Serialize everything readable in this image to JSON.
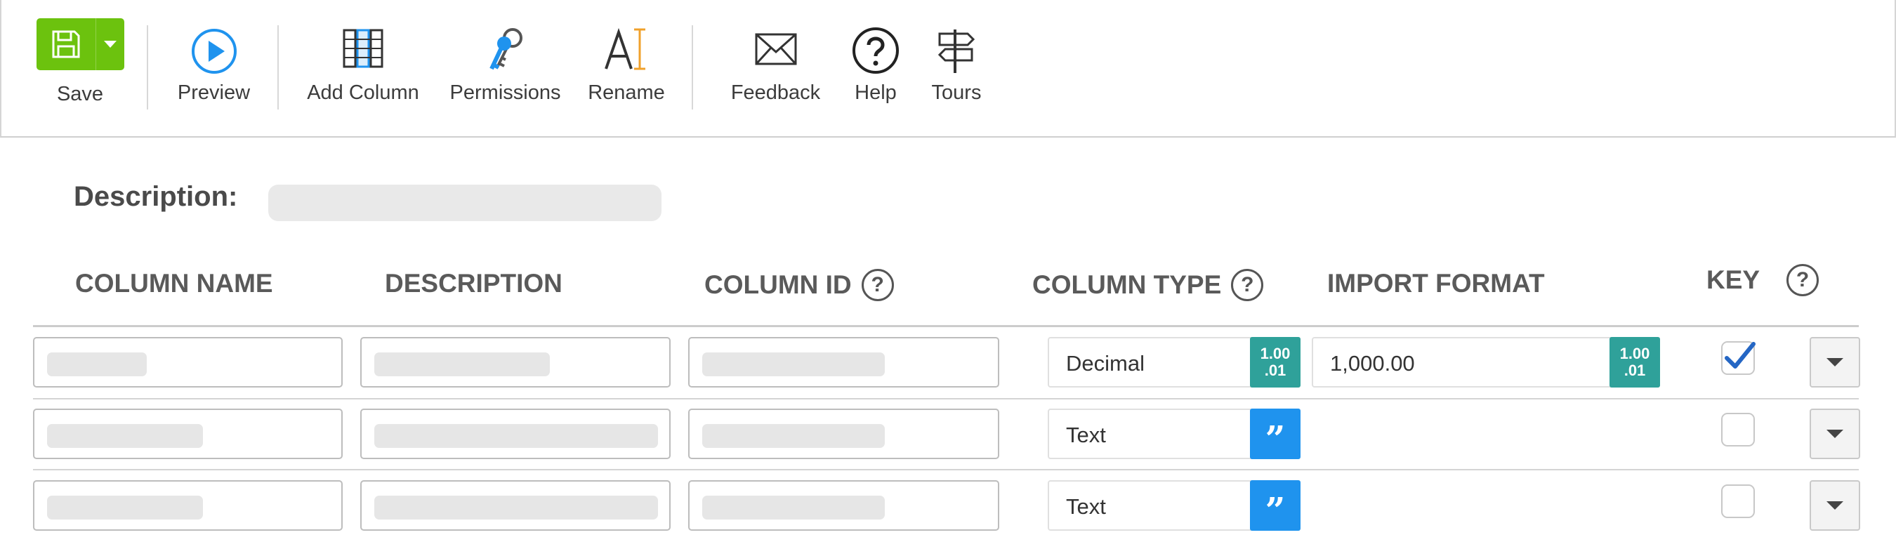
{
  "toolbar": {
    "save_label": "Save",
    "preview_label": "Preview",
    "add_column_label": "Add Column",
    "permissions_label": "Permissions",
    "rename_label": "Rename",
    "feedback_label": "Feedback",
    "help_label": "Help",
    "tours_label": "Tours",
    "icons": {
      "save": "floppy-disk-icon",
      "save_dropdown": "caret-down-icon",
      "preview": "play-circle-icon",
      "add_column": "columns-icon",
      "permissions": "keys-icon",
      "rename": "text-cursor-icon",
      "feedback": "envelope-icon",
      "help": "question-circle-icon",
      "tours": "signpost-icon"
    },
    "save_color": "#6cc20e",
    "preview_color": "#1f93ee"
  },
  "description": {
    "label": "Description:",
    "value": ""
  },
  "columns": {
    "headers": {
      "column_name": "COLUMN NAME",
      "description": "DESCRIPTION",
      "column_id": "COLUMN ID",
      "column_type": "COLUMN TYPE",
      "import_format": "IMPORT FORMAT",
      "key": "KEY"
    },
    "help_glyph": "?"
  },
  "rows": [
    {
      "column_type": "Decimal",
      "type_badge": {
        "top": "1.00",
        "bottom": ".01",
        "color": "#2fa19a"
      },
      "import_format": "1,000.00",
      "format_badge": {
        "top": "1.00",
        "bottom": ".01",
        "color": "#2fa19a"
      },
      "key": true
    },
    {
      "column_type": "Text",
      "type_badge": {
        "glyph": "”",
        "color": "#1f93ee"
      },
      "key": false
    },
    {
      "column_type": "Text",
      "type_badge": {
        "glyph": "”",
        "color": "#1f93ee"
      },
      "key": false
    }
  ]
}
